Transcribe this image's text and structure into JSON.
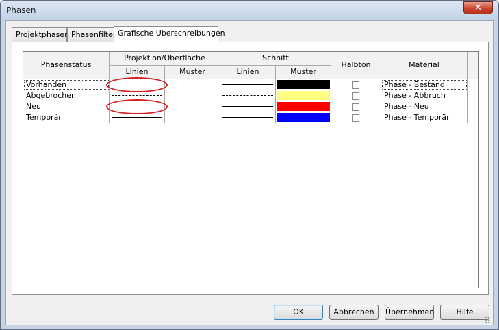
{
  "window": {
    "title": "Phasen",
    "close_label": "✕"
  },
  "tabs": [
    {
      "label": "Projektphasen"
    },
    {
      "label": "Phasenfilter"
    },
    {
      "label": "Grafische Überschreibungen"
    }
  ],
  "grid": {
    "headers": {
      "phasenstatus": "Phasenstatus",
      "projektion": "Projektion/Oberfläche",
      "projektion_linien": "Linien",
      "projektion_muster": "Muster",
      "schnitt": "Schnitt",
      "schnitt_linien": "Linien",
      "schnitt_muster": "Muster",
      "halbton": "Halbton",
      "material": "Material"
    },
    "rows": [
      {
        "status": "Vorhanden",
        "proj_line": "none",
        "schnitt_line": "solid",
        "schnitt_color": "#000000",
        "halbton": false,
        "material": "Phase - Bestand"
      },
      {
        "status": "Abgebrochen",
        "proj_line": "dashed",
        "schnitt_line": "dashed",
        "schnitt_color": "#ffff80",
        "halbton": false,
        "material": "Phase - Abbruch"
      },
      {
        "status": "Neu",
        "proj_line": "none",
        "schnitt_line": "solid",
        "schnitt_color": "#ff0000",
        "halbton": false,
        "material": "Phase - Neu"
      },
      {
        "status": "Temporär",
        "proj_line": "solid",
        "schnitt_line": "solid",
        "schnitt_color": "#0000ff",
        "halbton": false,
        "material": "Phase - Temporär"
      }
    ]
  },
  "annotations": {
    "color": "#d42020"
  },
  "buttons": {
    "ok": "OK",
    "cancel": "Abbrechen",
    "apply": "Übernehmen",
    "help": "Hilfe"
  }
}
